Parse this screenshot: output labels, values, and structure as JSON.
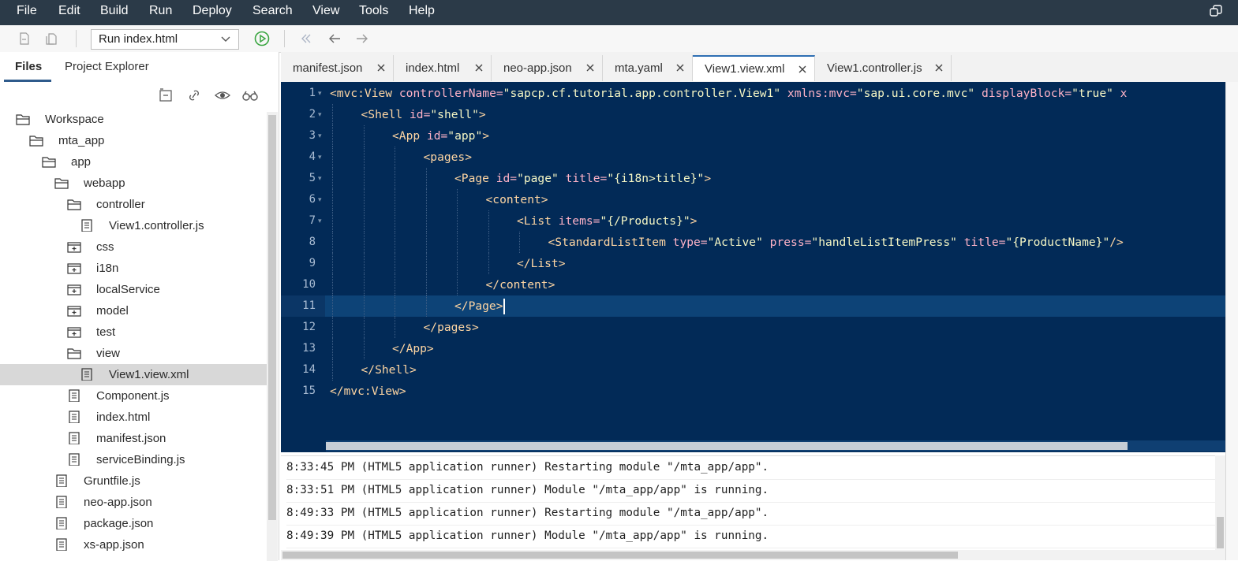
{
  "menubar": {
    "items": [
      "File",
      "Edit",
      "Build",
      "Run",
      "Deploy",
      "Search",
      "View",
      "Tools",
      "Help"
    ]
  },
  "toolbar": {
    "run_config": "Run index.html"
  },
  "left_panel": {
    "tabs": [
      "Files",
      "Project Explorer"
    ],
    "active_tab": "Files",
    "tree": [
      {
        "label": "Workspace",
        "type": "folder-open",
        "depth": 0
      },
      {
        "label": "mta_app",
        "type": "folder-open",
        "depth": 1
      },
      {
        "label": "app",
        "type": "folder-open",
        "depth": 2
      },
      {
        "label": "webapp",
        "type": "folder-open",
        "depth": 3
      },
      {
        "label": "controller",
        "type": "folder-open",
        "depth": 4
      },
      {
        "label": "View1.controller.js",
        "type": "file",
        "depth": 5
      },
      {
        "label": "css",
        "type": "folder-closed",
        "depth": 4
      },
      {
        "label": "i18n",
        "type": "folder-closed",
        "depth": 4
      },
      {
        "label": "localService",
        "type": "folder-closed",
        "depth": 4
      },
      {
        "label": "model",
        "type": "folder-closed",
        "depth": 4
      },
      {
        "label": "test",
        "type": "folder-closed",
        "depth": 4
      },
      {
        "label": "view",
        "type": "folder-open",
        "depth": 4
      },
      {
        "label": "View1.view.xml",
        "type": "file",
        "depth": 5,
        "selected": true
      },
      {
        "label": "Component.js",
        "type": "file",
        "depth": 4
      },
      {
        "label": "index.html",
        "type": "file",
        "depth": 4
      },
      {
        "label": "manifest.json",
        "type": "file",
        "depth": 4
      },
      {
        "label": "serviceBinding.js",
        "type": "file",
        "depth": 4
      },
      {
        "label": "Gruntfile.js",
        "type": "file",
        "depth": 3
      },
      {
        "label": "neo-app.json",
        "type": "file",
        "depth": 3
      },
      {
        "label": "package.json",
        "type": "file",
        "depth": 3
      },
      {
        "label": "xs-app.json",
        "type": "file",
        "depth": 3
      }
    ]
  },
  "editor_tabs": [
    {
      "label": "manifest.json"
    },
    {
      "label": "index.html"
    },
    {
      "label": "neo-app.json"
    },
    {
      "label": "mta.yaml"
    },
    {
      "label": "View1.view.xml",
      "active": true
    },
    {
      "label": "View1.controller.js"
    }
  ],
  "code": {
    "current_line": 11,
    "lines": [
      {
        "n": "1",
        "fold": true,
        "indent": 0,
        "tokens": [
          [
            "tag",
            "<mvc:View "
          ],
          [
            "attr",
            "controllerName="
          ],
          [
            "str",
            "\"sapcp.cf.tutorial.app.controller.View1\""
          ],
          [
            "attr",
            " xmlns:mvc="
          ],
          [
            "str",
            "\"sap.ui.core.mvc\""
          ],
          [
            "attr",
            " displayBlock="
          ],
          [
            "str",
            "\"true\""
          ],
          [
            "attr",
            " x"
          ]
        ]
      },
      {
        "n": "2",
        "fold": true,
        "indent": 1,
        "tokens": [
          [
            "tag",
            "<Shell "
          ],
          [
            "attr",
            "id="
          ],
          [
            "str",
            "\"shell\""
          ],
          [
            "tag",
            ">"
          ]
        ]
      },
      {
        "n": "3",
        "fold": true,
        "indent": 2,
        "tokens": [
          [
            "tag",
            "<App "
          ],
          [
            "attr",
            "id="
          ],
          [
            "str",
            "\"app\""
          ],
          [
            "tag",
            ">"
          ]
        ]
      },
      {
        "n": "4",
        "fold": true,
        "indent": 3,
        "tokens": [
          [
            "tag",
            "<pages>"
          ]
        ]
      },
      {
        "n": "5",
        "fold": true,
        "indent": 4,
        "tokens": [
          [
            "tag",
            "<Page "
          ],
          [
            "attr",
            "id="
          ],
          [
            "str",
            "\"page\""
          ],
          [
            "attr",
            " title="
          ],
          [
            "str",
            "\"{i18n>title}\""
          ],
          [
            "tag",
            ">"
          ]
        ]
      },
      {
        "n": "6",
        "fold": true,
        "indent": 5,
        "tokens": [
          [
            "tag",
            "<content>"
          ]
        ]
      },
      {
        "n": "7",
        "fold": true,
        "indent": 6,
        "tokens": [
          [
            "tag",
            "<List "
          ],
          [
            "attr",
            "items="
          ],
          [
            "str",
            "\"{/Products}\""
          ],
          [
            "tag",
            ">"
          ]
        ]
      },
      {
        "n": "8",
        "fold": false,
        "indent": 7,
        "tokens": [
          [
            "tag",
            "<StandardListItem "
          ],
          [
            "attr",
            "type="
          ],
          [
            "str",
            "\"Active\""
          ],
          [
            "attr",
            " press="
          ],
          [
            "str",
            "\"handleListItemPress\""
          ],
          [
            "attr",
            " title="
          ],
          [
            "str",
            "\"{ProductName}\""
          ],
          [
            "tag",
            "/>"
          ]
        ]
      },
      {
        "n": "9",
        "fold": false,
        "indent": 6,
        "tokens": [
          [
            "tag",
            "</List>"
          ]
        ]
      },
      {
        "n": "10",
        "fold": false,
        "indent": 5,
        "tokens": [
          [
            "tag",
            "</content>"
          ]
        ]
      },
      {
        "n": "11",
        "fold": false,
        "indent": 4,
        "tokens": [
          [
            "tag",
            "</Page>"
          ]
        ]
      },
      {
        "n": "12",
        "fold": false,
        "indent": 3,
        "tokens": [
          [
            "tag",
            "</pages>"
          ]
        ]
      },
      {
        "n": "13",
        "fold": false,
        "indent": 2,
        "tokens": [
          [
            "tag",
            "</App>"
          ]
        ]
      },
      {
        "n": "14",
        "fold": false,
        "indent": 1,
        "tokens": [
          [
            "tag",
            "</Shell>"
          ]
        ]
      },
      {
        "n": "15",
        "fold": false,
        "indent": 0,
        "tokens": [
          [
            "tag",
            "</mvc:View>"
          ]
        ]
      }
    ]
  },
  "console": {
    "lines": [
      "8:33:45 PM (HTML5 application runner) Restarting module \"/mta_app/app\".",
      "8:33:51 PM (HTML5 application runner) Module \"/mta_app/app\" is running.",
      "8:49:33 PM (HTML5 application runner) Restarting module \"/mta_app/app\".",
      "8:49:39 PM (HTML5 application runner) Module \"/mta_app/app\" is running."
    ]
  },
  "colors": {
    "menubar_bg": "#2b3a48",
    "editor_bg": "#022a57",
    "current_line_bg": "#0d4377",
    "tag": "#ffd6a3",
    "attr": "#ffb3c7",
    "string": "#f6f7c5",
    "run_green": "#3aa541"
  },
  "icons": {
    "restore": "restore-window-icon",
    "run": "run-play-icon",
    "folder_open": "folder-open-icon",
    "folder_closed": "folder-closed-icon",
    "file": "file-icon"
  }
}
